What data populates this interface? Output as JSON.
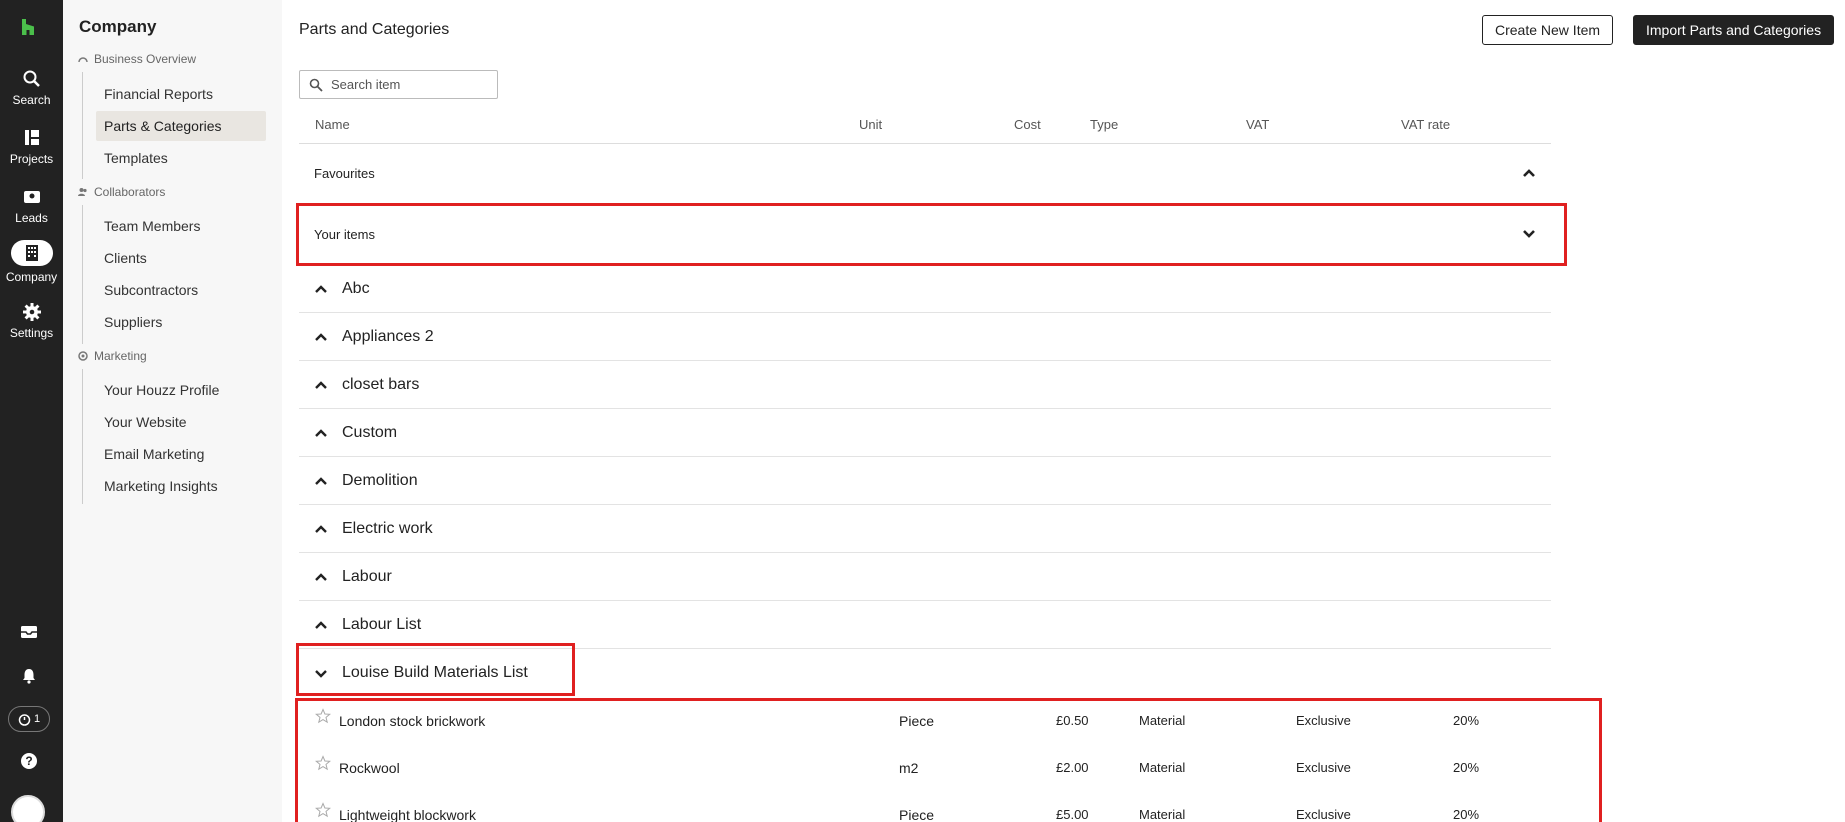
{
  "rail": {
    "items": [
      {
        "label": "Search",
        "icon": "search-icon"
      },
      {
        "label": "Projects",
        "icon": "projects-icon"
      },
      {
        "label": "Leads",
        "icon": "leads-icon"
      },
      {
        "label": "Company",
        "icon": "company-icon",
        "active": true
      },
      {
        "label": "Settings",
        "icon": "gear-icon"
      }
    ],
    "timer_count": "1"
  },
  "subnav": {
    "title": "Company",
    "groups": [
      {
        "label": "Business Overview",
        "links": [
          "Financial Reports",
          "Parts & Categories",
          "Templates"
        ]
      },
      {
        "label": "Collaborators",
        "links": [
          "Team Members",
          "Clients",
          "Subcontractors",
          "Suppliers"
        ]
      },
      {
        "label": "Marketing",
        "links": [
          "Your Houzz Profile",
          "Your Website",
          "Email Marketing",
          "Marketing Insights"
        ]
      }
    ],
    "active_link": "Parts & Categories"
  },
  "header": {
    "title": "Parts and Categories",
    "create_button": "Create New Item",
    "import_button": "Import Parts and Categories"
  },
  "search": {
    "placeholder": "Search item"
  },
  "table": {
    "columns": [
      "Name",
      "Unit",
      "Cost",
      "Type",
      "VAT",
      "VAT rate"
    ],
    "favourites_label": "Favourites",
    "your_items_label": "Your items",
    "categories": [
      "Abc",
      "Appliances 2",
      "closet bars",
      "Custom",
      "Demolition",
      "Electric work",
      "Labour",
      "Labour List",
      "Louise Build Materials List"
    ],
    "items": [
      {
        "name": "London stock brickwork",
        "unit": "Piece",
        "cost": "£0.50",
        "type": "Material",
        "vat": "Exclusive",
        "vat_rate": "20%"
      },
      {
        "name": "Rockwool",
        "unit": "m2",
        "cost": "£2.00",
        "type": "Material",
        "vat": "Exclusive",
        "vat_rate": "20%"
      },
      {
        "name": "Lightweight blockwork",
        "unit": "Piece",
        "cost": "£5.00",
        "type": "Material",
        "vat": "Exclusive",
        "vat_rate": "20%"
      }
    ]
  },
  "colors": {
    "rail": "#222222",
    "subnav": "#f7f7f7",
    "active_link": "#e9e6e1",
    "highlight": "#e02020"
  }
}
